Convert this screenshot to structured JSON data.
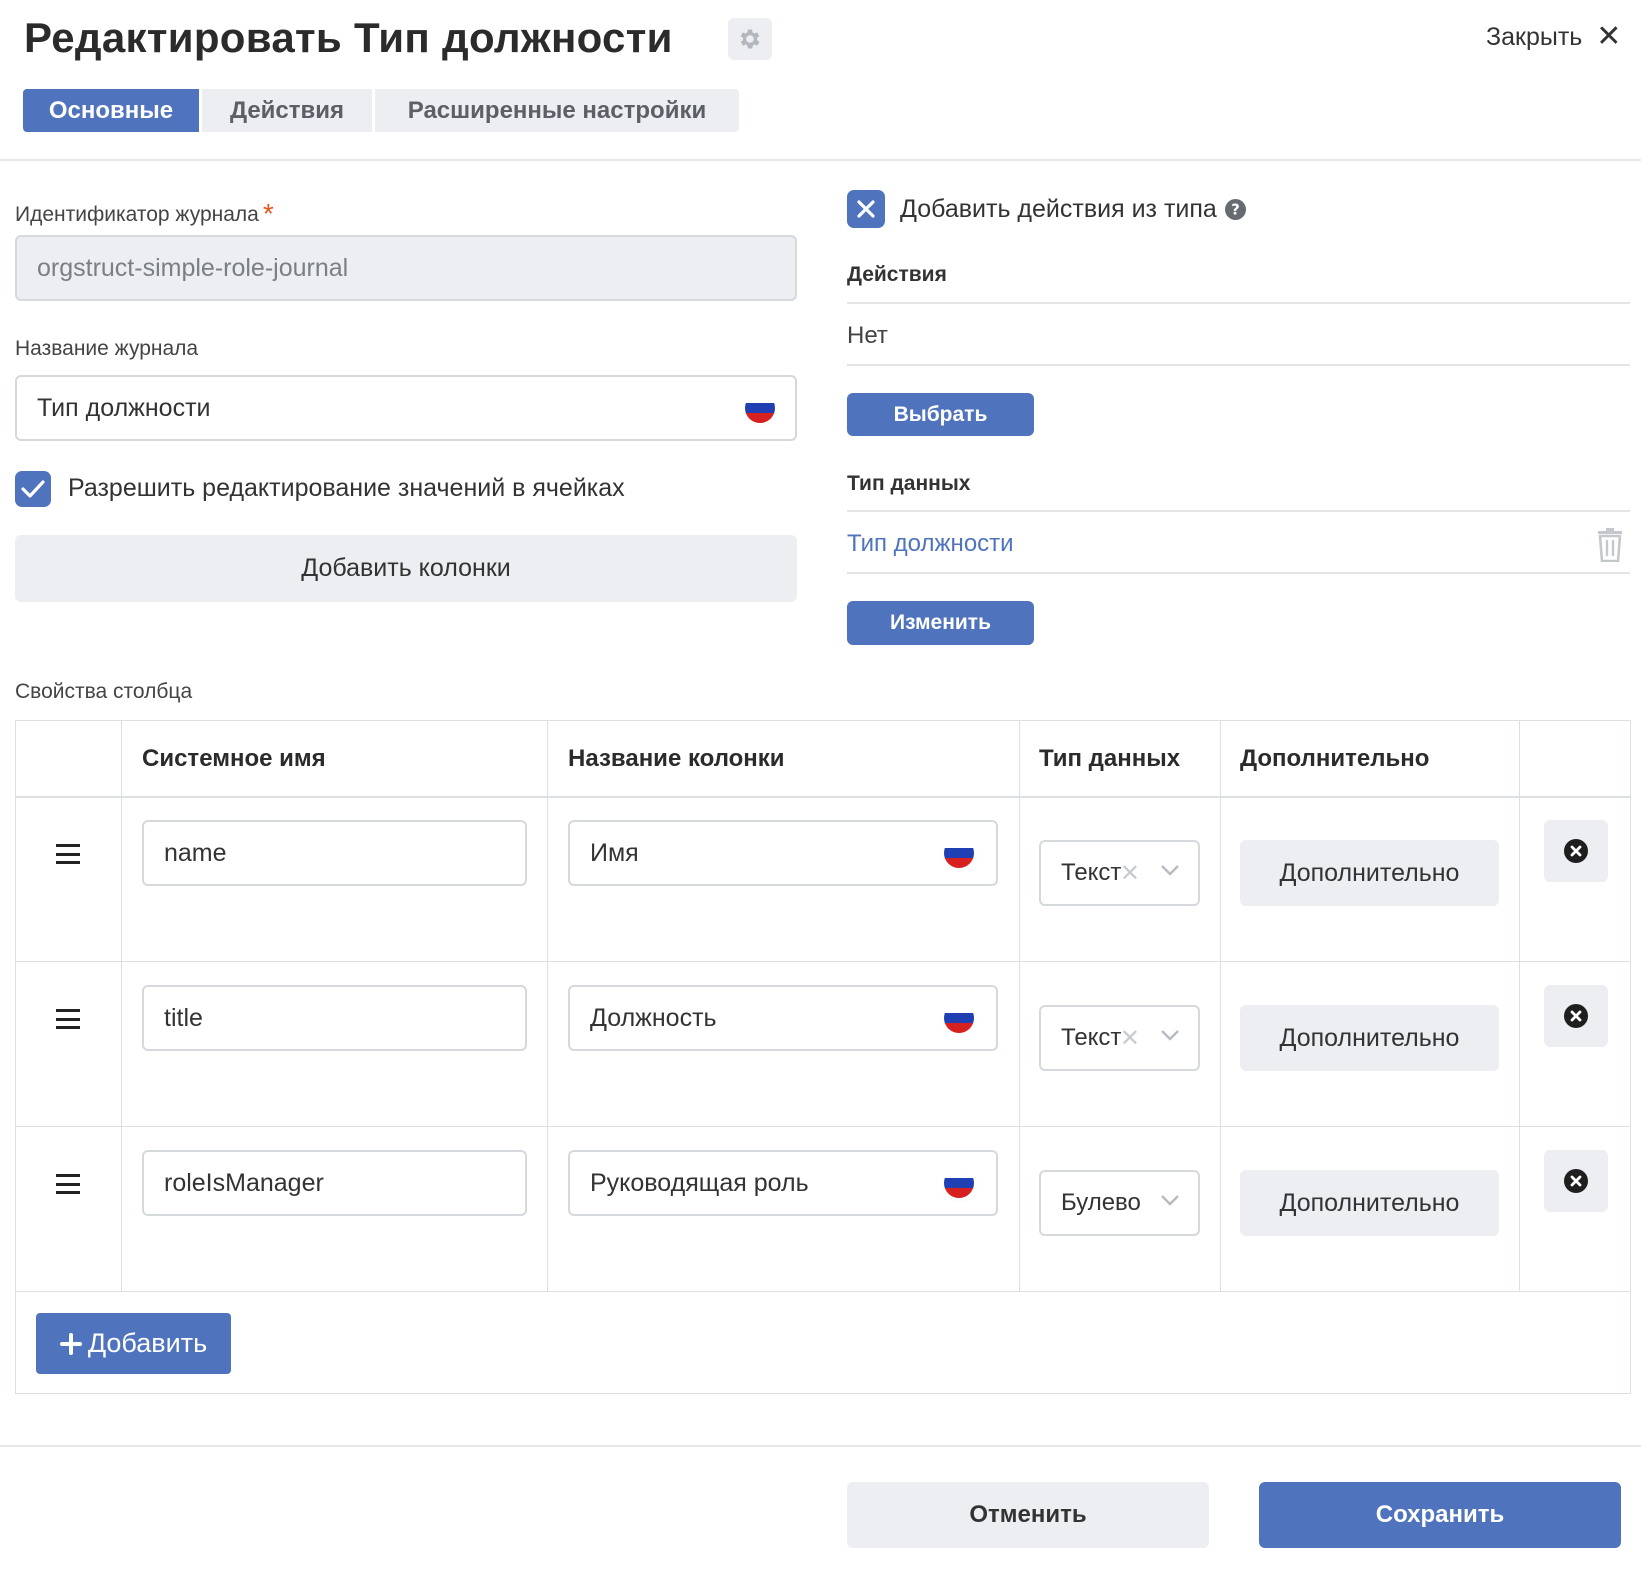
{
  "header": {
    "title": "Редактировать Тип должности",
    "close_label": "Закрыть"
  },
  "tabs": [
    {
      "label": "Основные",
      "active": true
    },
    {
      "label": "Действия",
      "active": false
    },
    {
      "label": "Расширенные настройки",
      "active": false
    }
  ],
  "form": {
    "journal_id_label": "Идентификатор журнала",
    "journal_id_required_mark": "*",
    "journal_id_value": "orgstruct-simple-role-journal",
    "journal_name_label": "Название журнала",
    "journal_name_value": "Тип должности",
    "allow_edit_label": "Разрешить редактирование значений в ячейках",
    "allow_edit_checked": true,
    "add_columns_label": "Добавить колонки"
  },
  "right": {
    "add_actions_from_type_label": "Добавить действия из типа",
    "actions_label": "Действия",
    "actions_value": "Нет",
    "choose_button": "Выбрать",
    "data_type_label": "Тип данных",
    "data_type_value": "Тип должности",
    "change_button": "Изменить"
  },
  "columns_section": {
    "label": "Свойства столбца",
    "headers": {
      "system_name": "Системное имя",
      "column_name": "Название колонки",
      "data_type": "Тип данных",
      "additional": "Дополнительно"
    },
    "rows": [
      {
        "system_name": "name",
        "column_name": "Имя",
        "data_type": "Текст",
        "additional_button": "Дополнительно"
      },
      {
        "system_name": "title",
        "column_name": "Должность",
        "data_type": "Текст",
        "additional_button": "Дополнительно"
      },
      {
        "system_name": "roleIsManager",
        "column_name": "Руководящая роль",
        "data_type": "Булево",
        "additional_button": "Дополнительно"
      }
    ],
    "add_button": "Добавить"
  },
  "footer": {
    "cancel_button": "Отменить",
    "save_button": "Сохранить"
  },
  "colors": {
    "accent": "#4f73bd",
    "required": "#e8541c",
    "link": "#4f73bd",
    "button_grey": "#eceef1"
  },
  "icons": [
    "gear-icon",
    "close-icon",
    "flag-ru-icon",
    "check-icon",
    "x-check-icon",
    "help-icon",
    "trash-icon",
    "drag-handle-icon",
    "chevron-down-icon",
    "remove-circle-icon",
    "plus-icon"
  ]
}
